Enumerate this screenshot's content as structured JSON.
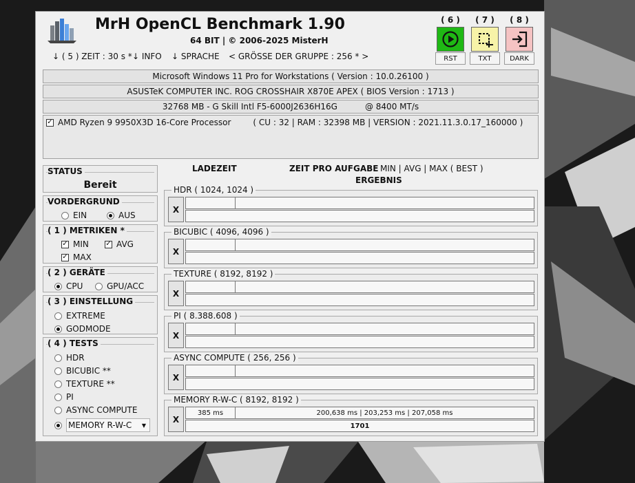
{
  "app": {
    "title": "MrH OpenCL Benchmark 1.90",
    "subtitle": "64 BIT | ©  2006-2025 MisterH"
  },
  "menu": {
    "zeit": "↓ ( 5 ) ZEIT : 30 s *",
    "info": "↓ INFO",
    "sprache": "↓ SPRACHE",
    "groesse": "< GRÖSSE DER GRUPPE : 256 * >"
  },
  "toolbar": [
    {
      "num": "( 6 )",
      "label": "RST",
      "icon": "play-circle-icon",
      "color": "#1fb814"
    },
    {
      "num": "( 7 )",
      "label": "TXT",
      "icon": "crop-icon",
      "color": "#f7f3a8"
    },
    {
      "num": "( 8 )",
      "label": "DARK",
      "icon": "sign-in-icon",
      "color": "#f5c3c3"
    }
  ],
  "system": {
    "os": "Microsoft Windows 11 Pro for Workstations ( Version : 10.0.26100 )",
    "board": "ASUSTeK COMPUTER INC. ROG CROSSHAIR X870E APEX ( BIOS Version : 1713 )",
    "ram": "32768 MB - G Skill Intl F5-6000J2636H16G",
    "ram_speed": "@ 8400 MT/s",
    "cpu": "AMD Ryzen 9 9950X3D 16-Core Processor",
    "cpu_details": "( CU : 32 | RAM : 32398 MB | VERSION : 2021.11.3.0.17_160000 )",
    "cpu_checked": true
  },
  "status": {
    "header": "STATUS",
    "value": "Bereit"
  },
  "vordergrund": {
    "header": "VORDERGRUND",
    "options": [
      "EIN",
      "AUS"
    ],
    "selected": 1
  },
  "metriken": {
    "header": "( 1 ) METRIKEN *",
    "items": [
      {
        "label": "MIN",
        "checked": true
      },
      {
        "label": "AVG",
        "checked": true
      },
      {
        "label": "MAX",
        "checked": true
      }
    ]
  },
  "geraete": {
    "header": "( 2 ) GERÄTE",
    "options": [
      "CPU",
      "GPU/ACC"
    ],
    "selected": 0
  },
  "einstellung": {
    "header": "( 3 ) EINSTELLUNG",
    "options": [
      "EXTREME",
      "GODMODE"
    ],
    "selected": 1
  },
  "tests": {
    "header": "( 4 ) TESTS",
    "options": [
      "HDR",
      "BICUBIC **",
      "TEXTURE **",
      "PI",
      "ASYNC COMPUTE",
      "MEMORY R-W-C"
    ],
    "selected": 5
  },
  "columns": {
    "ladezeit": "LADEZEIT",
    "zeit": "ZEIT PRO AUFGABE",
    "metrics": "MIN | AVG | MAX ( BEST )",
    "ergebnis": "ERGEBNIS"
  },
  "results": [
    {
      "title": "HDR ( 1024, 1024 )",
      "x": "X",
      "load": "",
      "time": "",
      "result": ""
    },
    {
      "title": "BICUBIC ( 4096, 4096 )",
      "x": "X",
      "load": "",
      "time": "",
      "result": ""
    },
    {
      "title": "TEXTURE ( 8192, 8192 )",
      "x": "X",
      "load": "",
      "time": "",
      "result": ""
    },
    {
      "title": "PI ( 8.388.608 )",
      "x": "X",
      "load": "",
      "time": "",
      "result": ""
    },
    {
      "title": "ASYNC COMPUTE ( 256, 256 )",
      "x": "X",
      "load": "",
      "time": "",
      "result": ""
    },
    {
      "title": "MEMORY R-W-C ( 8192, 8192 )",
      "x": "X",
      "load": "385 ms",
      "time": "200,638 ms | 203,253 ms | 207,058 ms",
      "result": "1701"
    }
  ]
}
